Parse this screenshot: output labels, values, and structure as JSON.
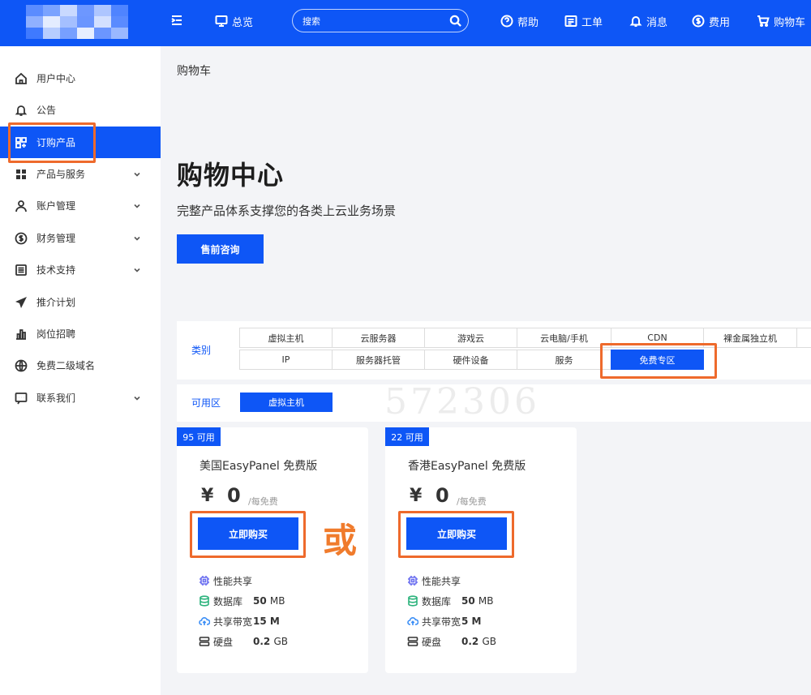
{
  "header": {
    "nav": [
      {
        "label": "总览",
        "icon": "monitor-icon"
      },
      {
        "label": "帮助",
        "icon": "help-icon"
      },
      {
        "label": "工单",
        "icon": "ticket-icon"
      },
      {
        "label": "消息",
        "icon": "bell-icon"
      },
      {
        "label": "费用",
        "icon": "dollar-icon"
      },
      {
        "label": "购物车",
        "icon": "cart-icon"
      }
    ],
    "search_placeholder": "搜索"
  },
  "sidebar": {
    "items": [
      {
        "label": "用户中心",
        "icon": "home-icon"
      },
      {
        "label": "公告",
        "icon": "bell-icon"
      },
      {
        "label": "订购产品",
        "icon": "grid-plus-icon",
        "active": true
      },
      {
        "label": "产品与服务",
        "icon": "grid-icon",
        "expandable": true
      },
      {
        "label": "账户管理",
        "icon": "user-icon",
        "expandable": true
      },
      {
        "label": "财务管理",
        "icon": "dollar-icon",
        "expandable": true
      },
      {
        "label": "技术支持",
        "icon": "list-icon",
        "expandable": true
      },
      {
        "label": "推介计划",
        "icon": "send-icon"
      },
      {
        "label": "岗位招聘",
        "icon": "chart-icon"
      },
      {
        "label": "免费二级域名",
        "icon": "globe-icon"
      },
      {
        "label": "联系我们",
        "icon": "chat-icon",
        "expandable": true
      }
    ]
  },
  "main": {
    "breadcrumb": "购物车",
    "hero_title": "购物中心",
    "hero_subtitle": "完整产品体系支撑您的各类上云业务场景",
    "presale_button": "售前咨询",
    "category_label": "类别",
    "categories_row1": [
      "虚拟主机",
      "云服务器",
      "游戏云",
      "云电脑/手机",
      "CDN",
      "裸金属独立机"
    ],
    "categories_row2": [
      "IP",
      "服务器托管",
      "硬件设备",
      "服务",
      "免费专区"
    ],
    "selected_category": "免费专区",
    "zone_label": "可用区",
    "zone_selected": "虚拟主机",
    "watermark": "572306",
    "or_text": "或",
    "products": [
      {
        "badge": "95 可用",
        "name": "美国EasyPanel 免费版",
        "currency": "¥",
        "price": "0",
        "price_unit": "/每免费",
        "buy_label": "立即购买",
        "features": [
          {
            "label": "性能共享",
            "value": "",
            "unit": ""
          },
          {
            "label": "数据库",
            "value": "50",
            "unit": "MB"
          },
          {
            "label": "共享带宽",
            "value": "15 M",
            "unit": ""
          },
          {
            "label": "硬盘",
            "value": "0.2",
            "unit": "GB"
          }
        ]
      },
      {
        "badge": "22 可用",
        "name": "香港EasyPanel 免费版",
        "currency": "¥",
        "price": "0",
        "price_unit": "/每免费",
        "buy_label": "立即购买",
        "features": [
          {
            "label": "性能共享",
            "value": "",
            "unit": ""
          },
          {
            "label": "数据库",
            "value": "50",
            "unit": "MB"
          },
          {
            "label": "共享带宽",
            "value": "5 M",
            "unit": ""
          },
          {
            "label": "硬盘",
            "value": "0.2",
            "unit": "GB"
          }
        ]
      }
    ]
  },
  "colors": {
    "brand": "#0e56f6",
    "highlight": "#ee6a2c",
    "or_text": "#f07b2c"
  }
}
